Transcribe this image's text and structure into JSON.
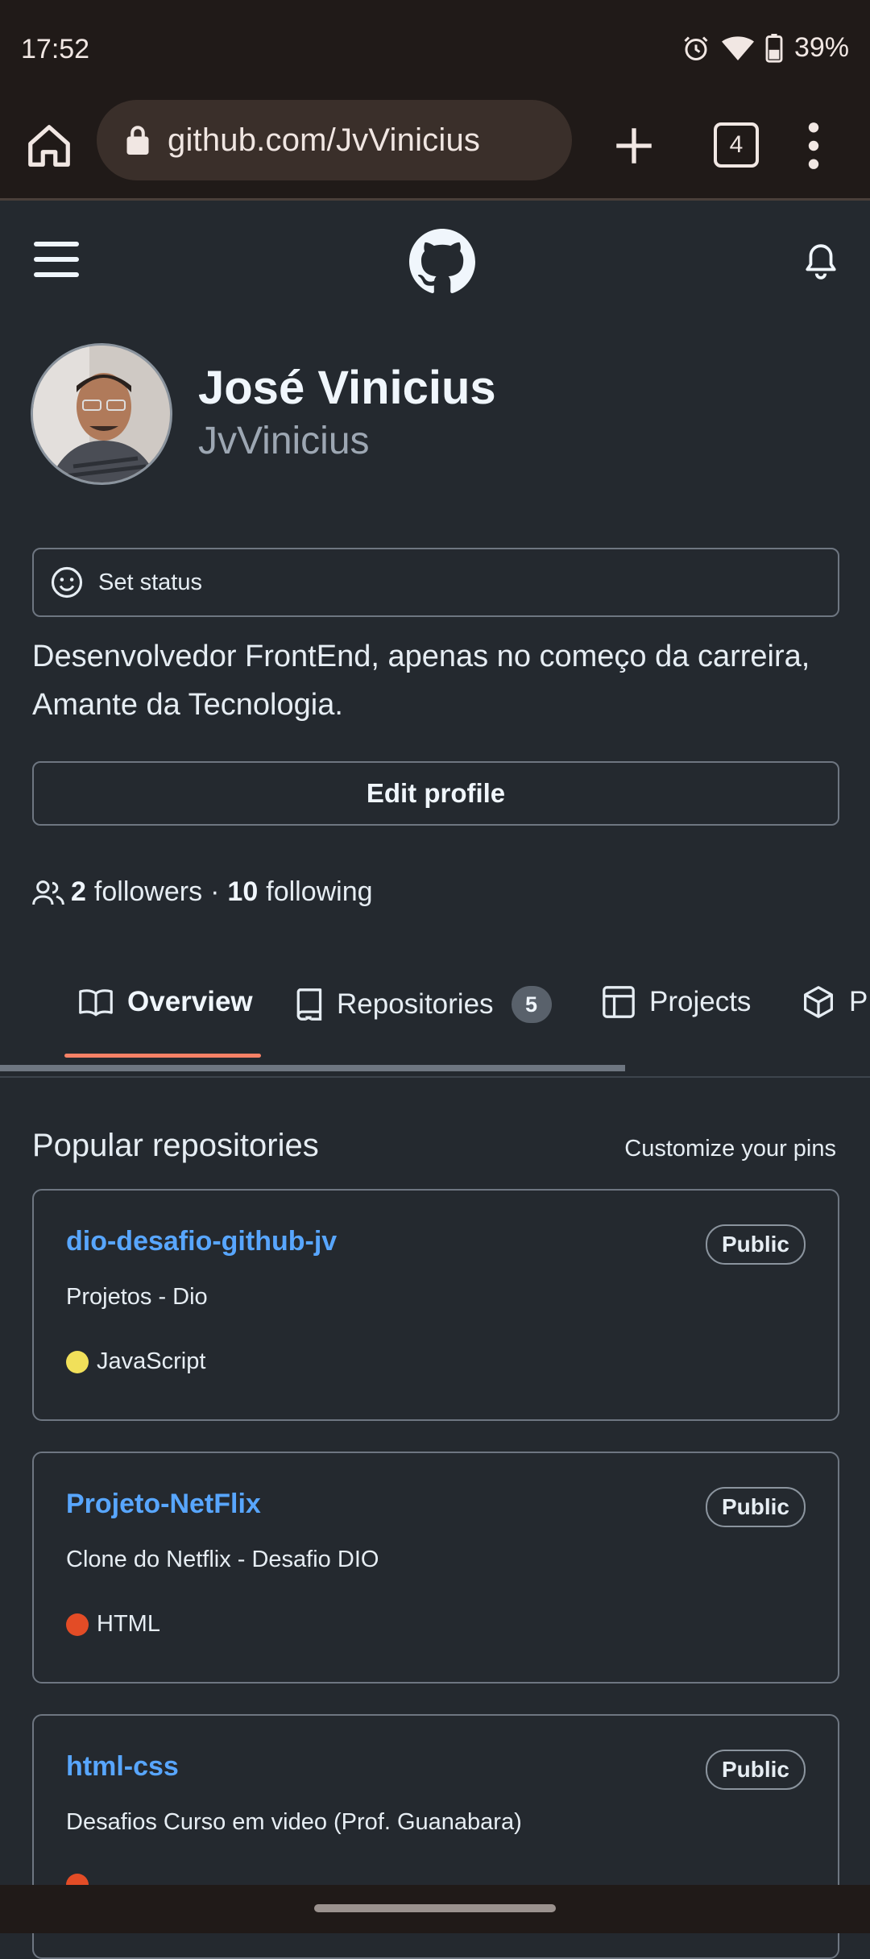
{
  "status_bar": {
    "time": "17:52",
    "battery": "39%"
  },
  "browser": {
    "url": "github.com/JvVinicius",
    "tab_count": "4"
  },
  "profile": {
    "name": "José Vinicius",
    "login": "JvVinicius",
    "status_label": "Set status",
    "bio": "Desenvolvedor FrontEnd, apenas no começo da carreira, Amante da Tecnologia.",
    "edit_label": "Edit profile",
    "followers_count": "2",
    "followers_label": "followers",
    "separator": "·",
    "following_count": "10",
    "following_label": "following"
  },
  "tabs": [
    {
      "label": "Overview",
      "icon": "book-icon",
      "active": true
    },
    {
      "label": "Repositories",
      "icon": "repo-icon",
      "counter": "5"
    },
    {
      "label": "Projects",
      "icon": "table-icon"
    },
    {
      "label": "P",
      "icon": "package-icon"
    }
  ],
  "popular": {
    "title": "Popular repositories",
    "customize_label": "Customize your pins",
    "repos": [
      {
        "name": "dio-desafio-github-jv",
        "visibility": "Public",
        "description": "Projetos - Dio",
        "language": "JavaScript",
        "lang_color": "#f1e05a"
      },
      {
        "name": "Projeto-NetFlix",
        "visibility": "Public",
        "description": "Clone do Netflix - Desafio DIO",
        "language": "HTML",
        "lang_color": "#e34c26"
      },
      {
        "name": "html-css",
        "visibility": "Public",
        "description": "Desafios Curso em video (Prof. Guanabara)",
        "language": "",
        "lang_color": "#e34c26"
      }
    ]
  },
  "colors": {
    "accent_link": "#58a6ff",
    "tab_underline": "#f78166",
    "background": "#24292f"
  }
}
